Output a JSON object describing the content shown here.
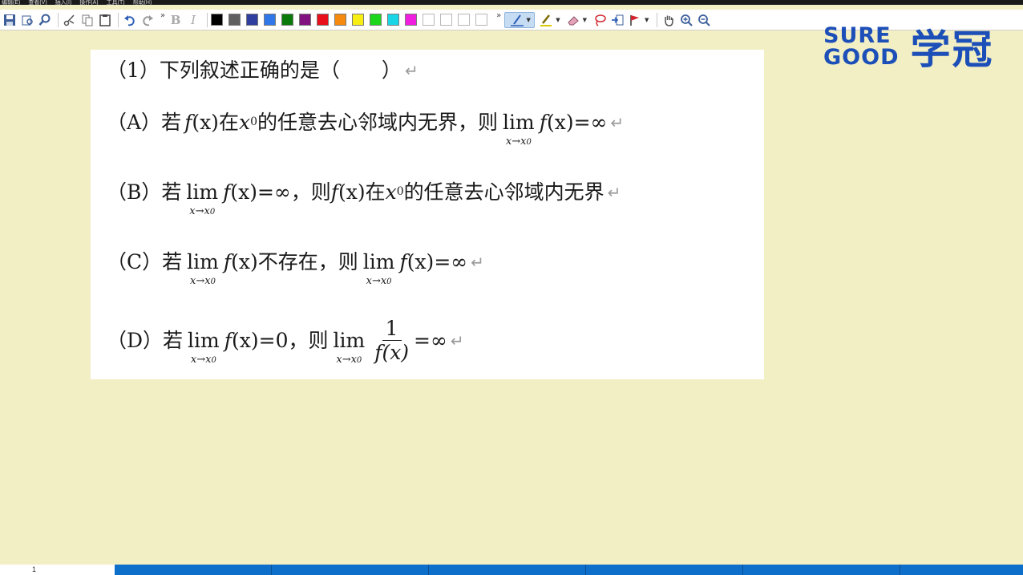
{
  "menu": {
    "items": [
      "编辑(E)",
      "查看(V)",
      "插入(I)",
      "操作(A)",
      "工具(T)",
      "帮助(H)"
    ]
  },
  "toolbar": {
    "bold_label": "B",
    "italic_label": "I",
    "more_glyph": "»",
    "colors": [
      "#000000",
      "#606060",
      "#2f3f9f",
      "#2f77e8",
      "#0a7a0a",
      "#82127f",
      "#e8101a",
      "#f58a0e",
      "#f7ef14",
      "#1bd61b",
      "#1ad5e6",
      "#f01fe0"
    ]
  },
  "logo": {
    "line1": "SURE",
    "line2": "GOOD",
    "chinese": "学冠"
  },
  "question": {
    "title": {
      "prefix": "（1）下列叙述正确的是（",
      "suffix": "）"
    },
    "options": [
      {
        "id": "A",
        "label": "（A）若",
        "m1": "f",
        "m1b": "(x)",
        "t2": "在",
        "m2": "x",
        "m2sub": "0",
        "t3": "的任意去心邻域内无界，则",
        "lim": "lim",
        "limsub": "x→x",
        "limsub0": "0",
        "m3": "f",
        "m3b": "(x)",
        "t4": "=∞"
      },
      {
        "id": "B",
        "label": "（B）若",
        "lim": "lim",
        "limsub": "x→x",
        "limsub0": "0",
        "m1": "f",
        "m1b": "(x)",
        "t2": "=∞，则",
        "m2": "f",
        "m2b": "(x)",
        "t3": "在",
        "m3": "x",
        "m3sub": "0",
        "t4": "的任意去心邻域内无界"
      },
      {
        "id": "C",
        "label": "（C）若",
        "lim": "lim",
        "limsub": "x→x",
        "limsub0": "0",
        "m1": "f",
        "m1b": "(x)",
        "t2": "不存在，则",
        "lim2": "lim",
        "m2": "f",
        "m2b": "(x)",
        "t3": "=∞"
      },
      {
        "id": "D",
        "label": "（D）若",
        "lim": "lim",
        "limsub": "x→x",
        "limsub0": "0",
        "m1": "f",
        "m1b": "(x)",
        "t2": "=0，则",
        "lim2": "lim",
        "num": "1",
        "den": "f(x)",
        "t3": "=∞"
      }
    ]
  },
  "return_glyph": "↵",
  "status": {
    "page": "1"
  }
}
